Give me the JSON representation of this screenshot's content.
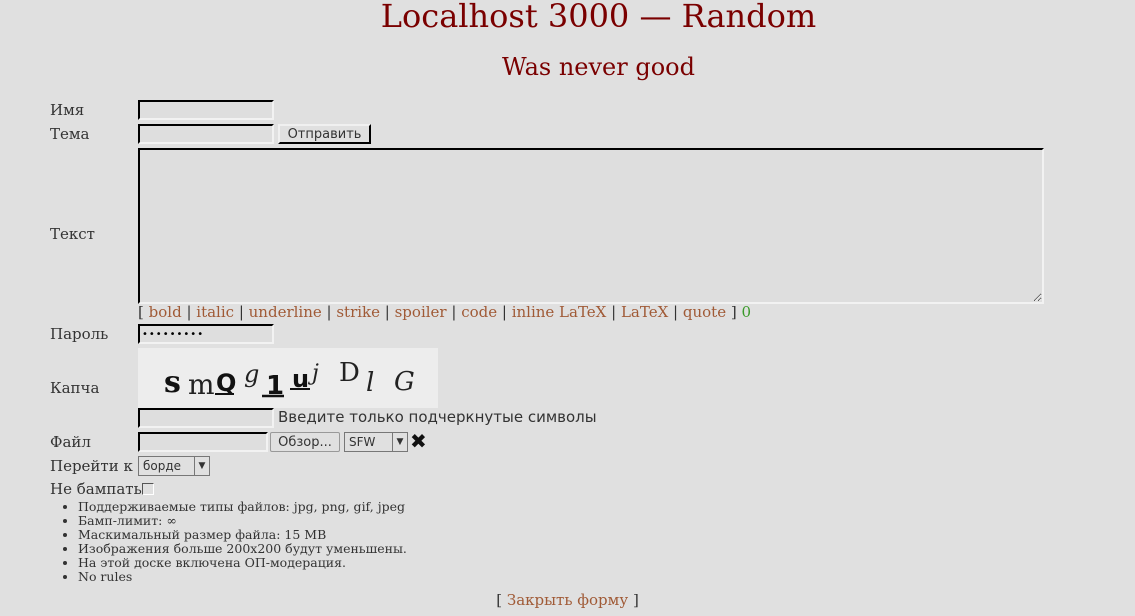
{
  "header": {
    "title": "Localhost 3000 — Random",
    "subtitle": "Was never good"
  },
  "form": {
    "name_label": "Имя",
    "name_value": "",
    "subject_label": "Тема",
    "subject_value": "",
    "send_button": "Отправить",
    "text_label": "Текст",
    "text_value": "",
    "markup": {
      "open": "[",
      "close": "]",
      "buttons": [
        "bold",
        "italic",
        "underline",
        "strike",
        "spoiler",
        "code",
        "inline LaTeX",
        "LaTeX",
        "quote"
      ],
      "char_count": "0"
    },
    "password_label": "Пароль",
    "password_value": "•••••••••",
    "captcha_label": "Капча",
    "captcha_chars": [
      "s",
      "m",
      "Q",
      "g",
      "1",
      "u",
      "j",
      "D",
      "l",
      "G"
    ],
    "captcha_value": "",
    "captcha_hint": "Введите только подчеркнутые символы",
    "file_label": "Файл",
    "browse_button": "Обзор...",
    "rating_select": "SFW",
    "remove_file_icon": "close-icon",
    "goto_label": "Перейти к",
    "goto_select": "борде",
    "nobump_label": "Не бампать",
    "nobump_checked": false
  },
  "rules": [
    "Поддерживаемые типы файлов: jpg, png, gif, jpeg",
    "Бамп-лимит: ∞",
    "Маскимальный размер файла: 15 MB",
    "Изображения больше 200x200 будут уменьшены.",
    "На этой доске включена ОП-модерация.",
    "No rules"
  ],
  "footer": {
    "open": "[",
    "close_form_link": "Закрыть форму",
    "close": "]"
  },
  "colors": {
    "background": "#e0e0e0",
    "title": "#7a0000",
    "link": "#a05a36",
    "counter": "#3a9a2a"
  }
}
